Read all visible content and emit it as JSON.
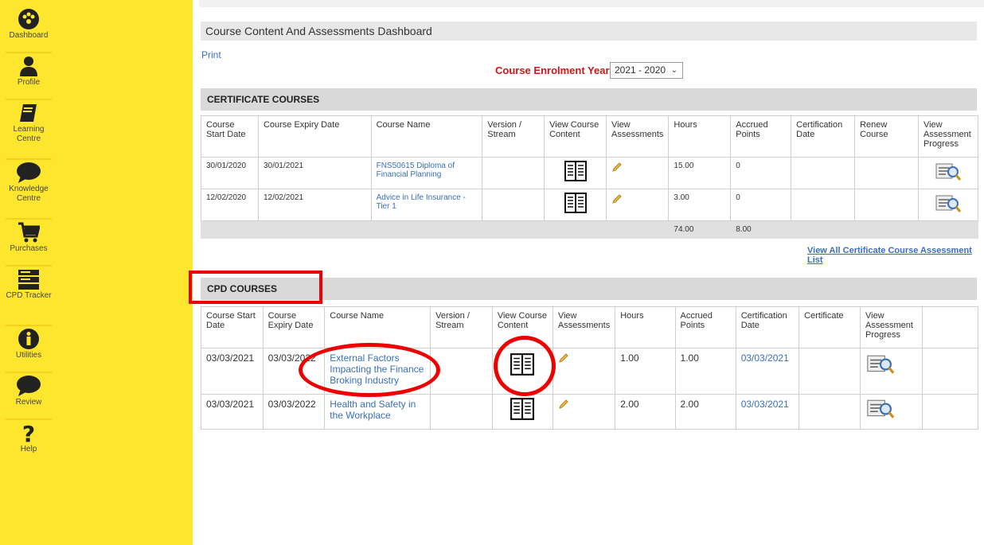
{
  "nav": [
    {
      "label": "Dashboard",
      "icon": "dashboard-icon"
    },
    {
      "label": "Profile",
      "icon": "user-icon"
    },
    {
      "label": "Learning Centre",
      "icon": "book-icon"
    },
    {
      "label": "Knowledge Centre",
      "icon": "chat-bubble-icon"
    },
    {
      "label": "Purchases",
      "icon": "cart-icon"
    },
    {
      "label": "CPD Tracker",
      "icon": "tracker-icon"
    },
    {
      "label": "Utilities",
      "icon": "info-icon"
    },
    {
      "label": "Review",
      "icon": "chat-bubble-icon"
    },
    {
      "label": "Help",
      "icon": "help-icon"
    }
  ],
  "page": {
    "title": "Course Content And Assessments Dashboard",
    "print": "Print",
    "year_label": "Course Enrolment Year",
    "year_value": "2021 - 2020"
  },
  "certificate": {
    "heading": "CERTIFICATE COURSES",
    "headers": [
      "Course Start Date",
      "Course Expiry Date",
      "Course Name",
      "Version / Stream",
      "View Course Content",
      "View Assessments",
      "Hours",
      "Accrued Points",
      "Certification Date",
      "Renew Course",
      "View Assessment Progress"
    ],
    "rows": [
      {
        "start": "30/01/2020",
        "expiry": "30/01/2021",
        "name": "FNS50615 Diploma of Financial Planning",
        "hours": "15.00",
        "points": "0"
      },
      {
        "start": "12/02/2020",
        "expiry": "12/02/2021",
        "name": "Advice in Life Insurance - Tier 1",
        "hours": "3.00",
        "points": "0"
      }
    ],
    "total_hours": "74.00",
    "total_points": "8.00",
    "view_all": "View All Certificate Course Assessment List"
  },
  "cpd": {
    "heading": "CPD COURSES",
    "headers": [
      "Course Start Date",
      "Course Expiry Date",
      "Course Name",
      "Version / Stream",
      "View Course Content",
      "View Assessments",
      "Hours",
      "Accrued Points",
      "Certification Date",
      "Certificate",
      "View Assessment Progress"
    ],
    "rows": [
      {
        "start": "03/03/2021",
        "expiry": "03/03/2022",
        "name": "External Factors Impacting the Finance Broking Industry",
        "hours": "1.00",
        "points": "1.00",
        "cert_date": "03/03/2021"
      },
      {
        "start": "03/03/2021",
        "expiry": "03/03/2022",
        "name": "Health and Safety in the Workplace",
        "hours": "2.00",
        "points": "2.00",
        "cert_date": "03/03/2021"
      }
    ]
  },
  "colors": {
    "sidebar": "#ffe62e",
    "link": "#3a6fb5",
    "highlight": "#e00000",
    "year_label": "#c81818"
  }
}
